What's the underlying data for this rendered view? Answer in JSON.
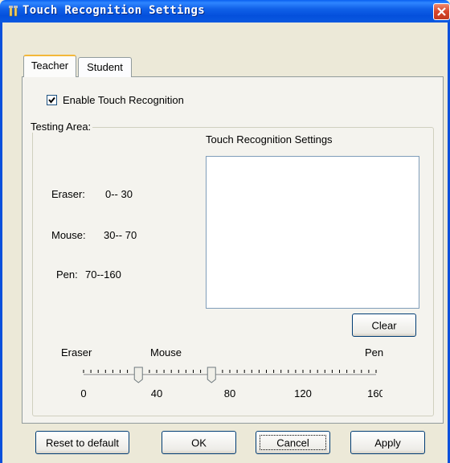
{
  "window": {
    "title": "Touch Recognition Settings",
    "title_icon": "tools-icon",
    "close_icon": "close-icon",
    "accent": "#0a58e0"
  },
  "tabs": [
    {
      "label": "Teacher",
      "active": true
    },
    {
      "label": "Student",
      "active": false
    }
  ],
  "enable_checkbox": {
    "label": "Enable Touch Recognition",
    "checked": true
  },
  "testing_area": {
    "legend": "Testing Area:",
    "canvas_heading": "Touch Recognition Settings",
    "ranges": [
      {
        "name": "Eraser:",
        "range": "0-- 30"
      },
      {
        "name": "Mouse:",
        "range": "30-- 70"
      },
      {
        "name": "Pen:",
        "range": "70--160"
      }
    ],
    "clear_label": "Clear"
  },
  "slider": {
    "labels": {
      "eraser": "Eraser",
      "mouse": "Mouse",
      "pen": "Pen"
    },
    "min": 0,
    "max": 160,
    "thumb_values": [
      30,
      70
    ],
    "tick_labels": [
      "0",
      "40",
      "80",
      "120",
      "160"
    ]
  },
  "buttons": {
    "reset": "Reset to default",
    "ok": "OK",
    "cancel": "Cancel",
    "apply": "Apply"
  }
}
